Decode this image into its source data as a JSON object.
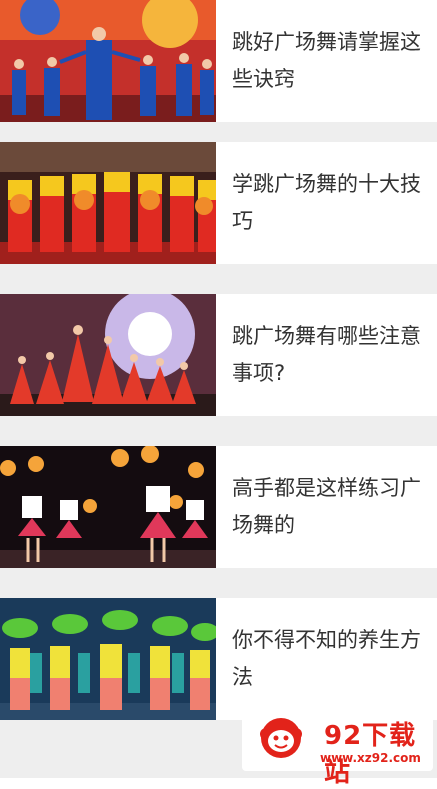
{
  "articles": [
    {
      "title_line1": "跳好广场舞请掌握这",
      "title_line2": "些诀窍",
      "thumb_icon": "dance-photo-blue-costumes"
    },
    {
      "title_line1": "学跳广场舞的十大技",
      "title_line2": "巧",
      "thumb_icon": "dance-photo-red-yellow-fans"
    },
    {
      "title_line1": "跳广场舞有哪些注意",
      "title_line2": "事项?",
      "thumb_icon": "dance-photo-red-dresses-stage"
    },
    {
      "title_line1": "高手都是这样练习广",
      "title_line2": "场舞的",
      "thumb_icon": "dance-photo-cheerleaders-pompoms"
    },
    {
      "title_line1": "你不得不知的养生方",
      "title_line2": "法",
      "thumb_icon": "dance-photo-green-fans"
    }
  ],
  "watermark": {
    "name": "92下载站",
    "url": "www.xz92.com"
  }
}
